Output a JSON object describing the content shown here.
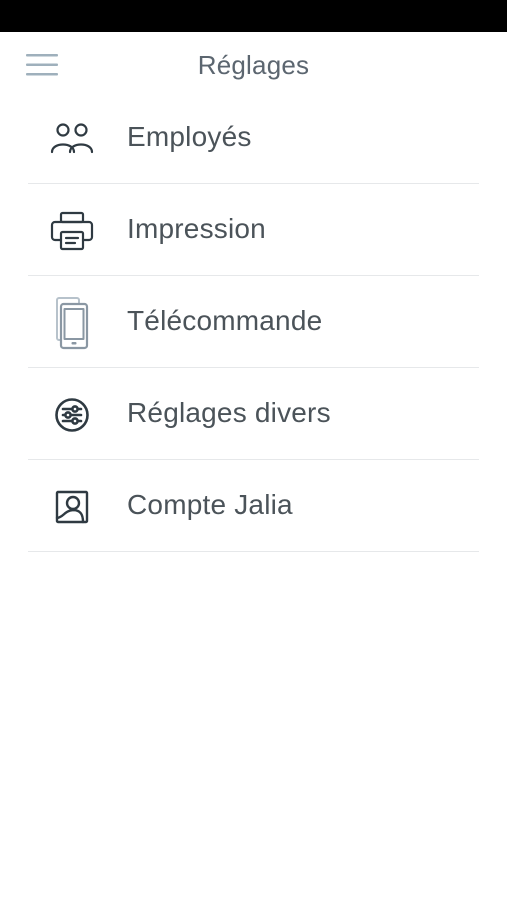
{
  "header": {
    "title": "Réglages",
    "menu_icon": "hamburger-menu-icon"
  },
  "settings": {
    "items": [
      {
        "label": "Employés",
        "icon": "users-icon"
      },
      {
        "label": "Impression",
        "icon": "printer-icon"
      },
      {
        "label": "Télécommande",
        "icon": "smartphone-icon"
      },
      {
        "label": "Réglages divers",
        "icon": "sliders-icon"
      },
      {
        "label": "Compte Jalia",
        "icon": "user-account-icon"
      }
    ]
  },
  "colors": {
    "status_bar": "#000000",
    "background": "#ffffff",
    "text": "#4b5359",
    "title": "#5c6670",
    "divider": "#e6e8ea",
    "icon_dark": "#2f3a42",
    "icon_muted": "#8a97a3",
    "hamburger": "#9fb0bc"
  }
}
